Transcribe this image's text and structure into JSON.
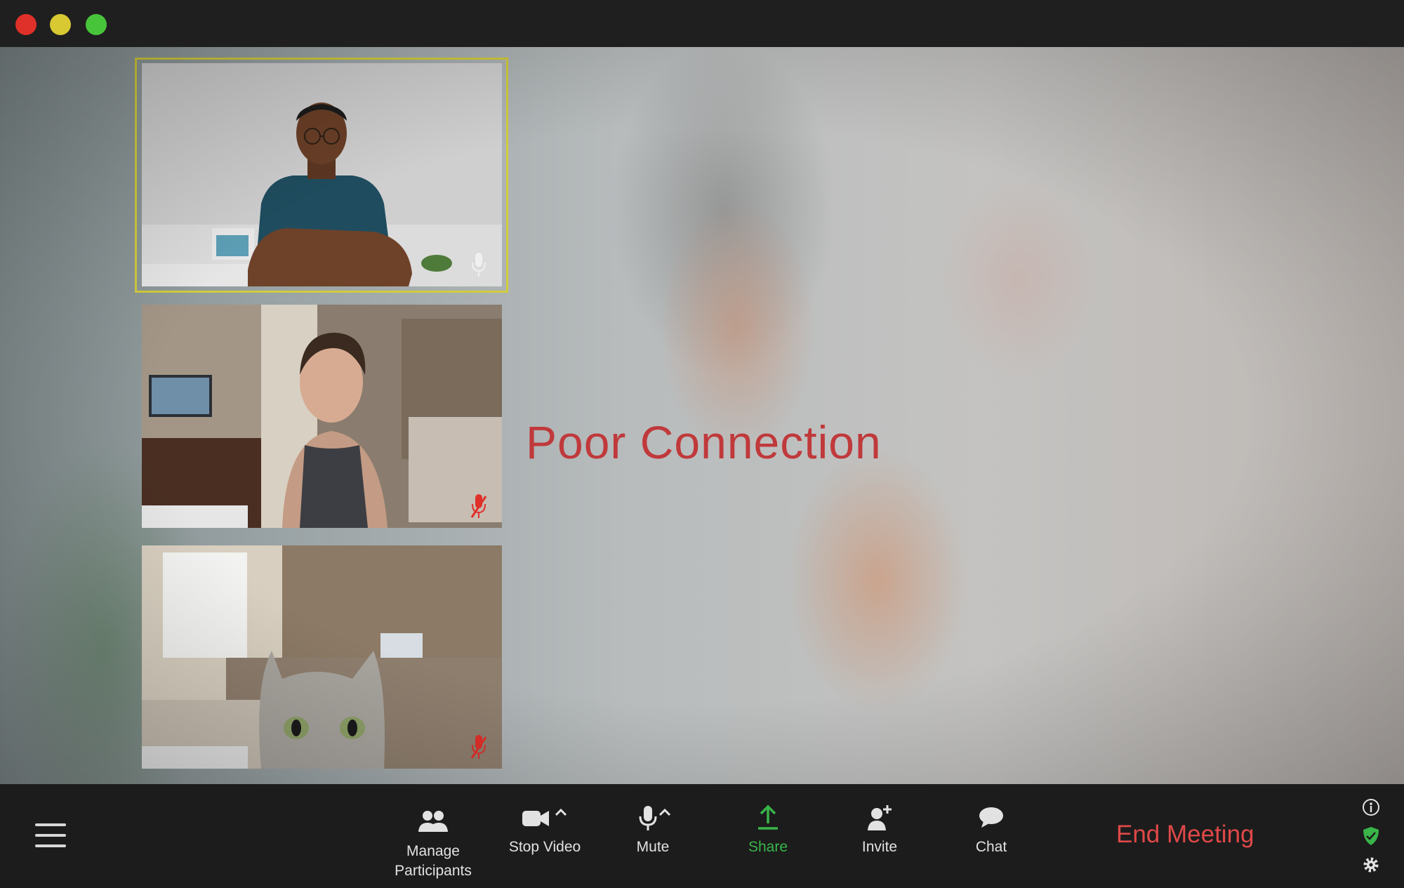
{
  "window": {
    "controls": [
      "close",
      "minimize",
      "maximize"
    ],
    "colors": {
      "close": "#e0302a",
      "minimize": "#d8c832",
      "maximize": "#48c43a"
    }
  },
  "stage": {
    "status_text": "Poor Connection",
    "status_color": "#c0393b",
    "active_speaker_border": "#d2cc3c",
    "participants": [
      {
        "id": "participant-1",
        "mic": "on",
        "active": true
      },
      {
        "id": "participant-2",
        "mic": "muted",
        "active": false
      },
      {
        "id": "participant-3",
        "mic": "muted",
        "active": false
      }
    ]
  },
  "toolbar": {
    "menu_icon": "hamburger-menu-icon",
    "manage_participants_label": "Manage\nParticipants",
    "stop_video_label": "Stop Video",
    "mute_label": "Mute",
    "share_label": "Share",
    "invite_label": "Invite",
    "chat_label": "Chat",
    "end_meeting_label": "End Meeting",
    "share_color": "#39b54a",
    "end_color": "#e04848",
    "side_icons": [
      "info-icon",
      "security-shield-icon",
      "settings-gear-icon"
    ]
  }
}
